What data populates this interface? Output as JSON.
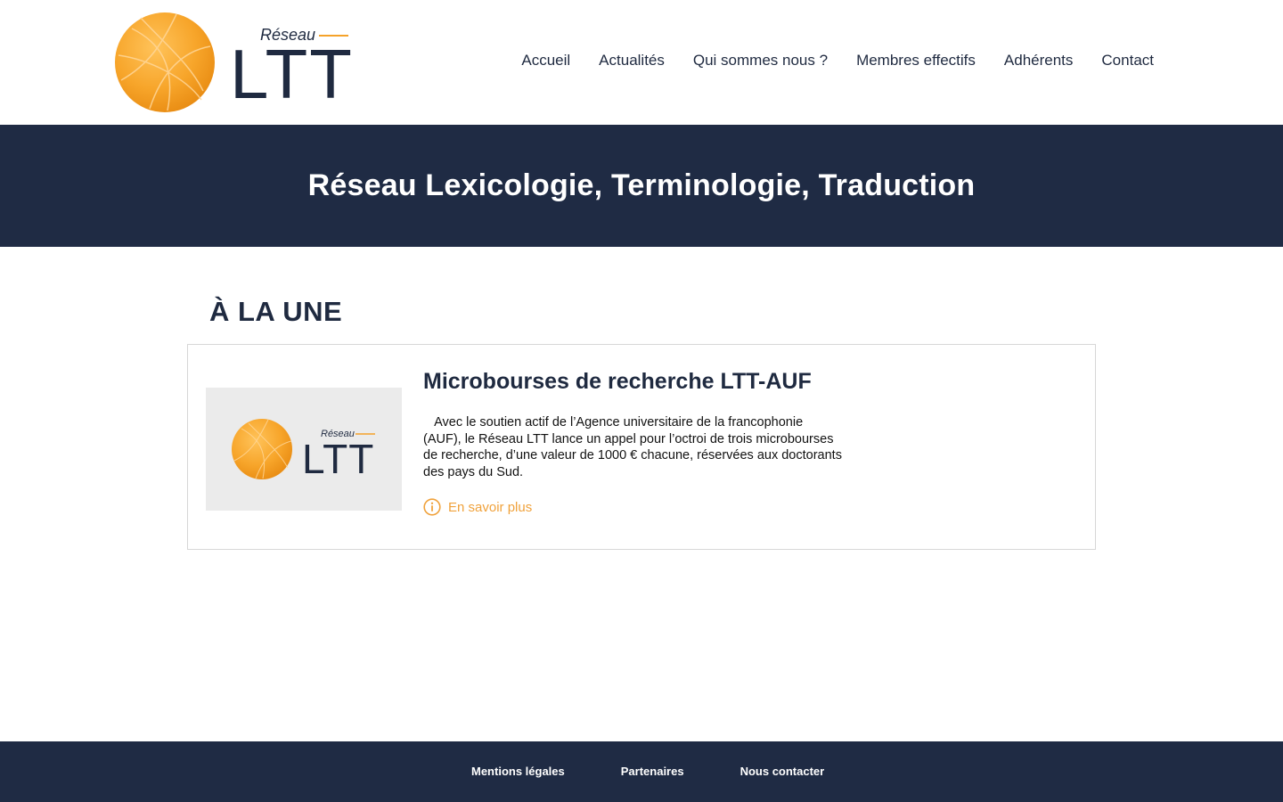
{
  "header": {
    "logo": {
      "icon": "orange-sphere-logo-icon",
      "small_text": "Réseau",
      "big_text": "LTT",
      "orange_color": "#f5a22a",
      "navy_color": "#1f2a40"
    },
    "nav": [
      {
        "label": "Accueil"
      },
      {
        "label": "Actualités"
      },
      {
        "label": "Qui sommes nous ?"
      },
      {
        "label": "Membres effectifs"
      },
      {
        "label": "Adhérents"
      },
      {
        "label": "Contact"
      }
    ]
  },
  "banner": {
    "title": "Réseau Lexicologie, Terminologie, Traduction",
    "background": "#1f2b44"
  },
  "main": {
    "section_title": "À LA UNE",
    "card": {
      "title": "Microbourses de recherche LTT-AUF",
      "text": "Avec le soutien actif de l’Agence universitaire de la francophonie (AUF), le Réseau LTT lance un appel pour l’octroi de trois microbourses de recherche, d’une valeur de 1000 € chacune, réservées aux doctorants des pays du Sud.",
      "read_more": "En savoir plus",
      "read_more_icon": "info-circle-icon",
      "accent_color": "#f0a23c",
      "thumbnail": {
        "small_text": "Réseau",
        "big_text": "LTT"
      }
    }
  },
  "footer": {
    "links": [
      {
        "label": "Mentions légales"
      },
      {
        "label": "Partenaires"
      },
      {
        "label": "Nous contacter"
      }
    ]
  }
}
